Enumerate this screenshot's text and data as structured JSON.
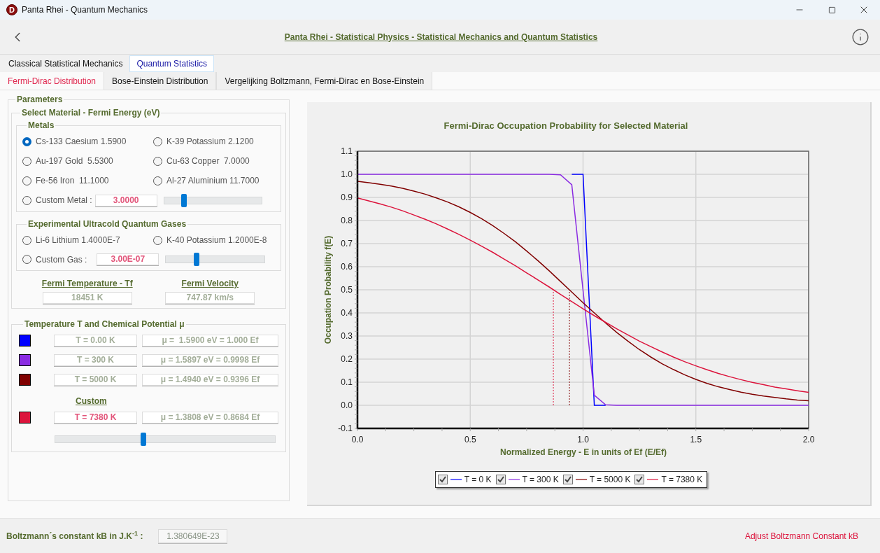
{
  "window": {
    "icon_letter": "D",
    "title": "Panta Rhei - Quantum Mechanics"
  },
  "header": {
    "title": "Panta Rhei - Statistical Physics - Statistical Mechanics and Quantum Statistics"
  },
  "tabs": [
    {
      "label": "Classical Statistical Mechanics",
      "selected": false
    },
    {
      "label": "Quantum Statistics",
      "selected": true
    }
  ],
  "subtabs": [
    {
      "label": "Fermi-Dirac Distribution",
      "selected": true
    },
    {
      "label": "Bose-Einstein Distribution",
      "selected": false
    },
    {
      "label": "Vergelijking Boltzmann, Fermi-Dirac en Bose-Einstein",
      "selected": false
    }
  ],
  "parameters": {
    "title": "Parameters",
    "material": {
      "title": "Select Material - Fermi Energy (eV)",
      "metals": {
        "title": "Metals",
        "options": [
          {
            "label": "Cs-133 Caesium 1.5900",
            "selected": true
          },
          {
            "label": "K-39 Potassium 2.1200",
            "selected": false
          },
          {
            "label": "Au-197 Gold  5.5300",
            "selected": false
          },
          {
            "label": "Cu-63 Copper  7.0000",
            "selected": false
          },
          {
            "label": "Fe-56 Iron  11.1000",
            "selected": false
          },
          {
            "label": "Al-27 Aluminium 11.7000",
            "selected": false
          }
        ],
        "custom": {
          "label": "Custom Metal :",
          "value": "3.0000",
          "selected": false,
          "level": 0.2
        }
      },
      "gases": {
        "title": "Experimental Ultracold Quantum Gases",
        "options": [
          {
            "label": "Li-6 Lithium 1.4000E-7",
            "selected": false
          },
          {
            "label": "K-40 Potassium 1.2000E-8",
            "selected": false
          }
        ],
        "custom": {
          "label": "Custom Gas :",
          "value": "3.00E-07",
          "selected": false,
          "level": 0.31
        }
      },
      "fermi_temperature": {
        "label": "Fermi Temperature - Tf",
        "value": "18451 K"
      },
      "fermi_velocity": {
        "label": "Fermi Velocity",
        "value": "747.87 km/s"
      }
    },
    "temperature": {
      "title": "Temperature T and Chemical Potential μ",
      "custom_label": "Custom",
      "rows": [
        {
          "kind": "preset",
          "color": "#0000ff",
          "temperature": "T = 0.00 K",
          "potential": "μ =  1.5900 eV = 1.000 Ef"
        },
        {
          "kind": "preset",
          "color": "#8a2be2",
          "temperature": "T = 300 K",
          "potential": "μ = 1.5897 eV = 0.9998 Ef"
        },
        {
          "kind": "preset",
          "color": "#800000",
          "temperature": "T = 5000 K",
          "potential": "μ = 1.4940 eV = 0.9396 Ef"
        },
        {
          "kind": "custom",
          "color": "#dc143c",
          "temperature": "T = 7380 K",
          "potential": "μ = 1.3808 eV = 0.8684 Ef"
        }
      ],
      "slider": {
        "level": 0.4
      }
    }
  },
  "chart": {
    "legend_checkboxes": [
      {
        "checked": true
      },
      {
        "checked": true
      },
      {
        "checked": true
      },
      {
        "checked": true
      }
    ],
    "chart_data": {
      "type": "line",
      "title": "Fermi-Dirac Occupation Probability for Selected Material",
      "xlabel": "Normalized Energy - E in units of Ef (E/Ef)",
      "ylabel": "Occupation Probability f(E)",
      "x": [
        0,
        0.05,
        0.1,
        0.15,
        0.2,
        0.25,
        0.3,
        0.35,
        0.4,
        0.45,
        0.5,
        0.55,
        0.6,
        0.65,
        0.7,
        0.75,
        0.8,
        0.85,
        0.9,
        0.95,
        1.0,
        1.05,
        1.1,
        1.15,
        1.2,
        1.25,
        1.3,
        1.35,
        1.4,
        1.45,
        1.5,
        1.55,
        1.6,
        1.65,
        1.7,
        1.75,
        1.8,
        1.85,
        1.9,
        1.95,
        2.0
      ],
      "series": [
        {
          "name": "T = 0 K",
          "color": "#0000ff",
          "values": [
            null,
            null,
            null,
            null,
            null,
            null,
            null,
            null,
            null,
            null,
            null,
            null,
            null,
            null,
            null,
            null,
            null,
            null,
            null,
            1,
            1,
            0,
            0,
            null,
            null,
            null,
            null,
            null,
            null,
            null,
            null,
            null,
            null,
            null,
            null,
            null,
            null,
            null,
            null,
            null,
            null
          ]
        },
        {
          "name": "T = 300 K",
          "color": "#8a2be2",
          "values": [
            1,
            1,
            1,
            1,
            1,
            1,
            1,
            1,
            1,
            1,
            1,
            1,
            1,
            1,
            1,
            1,
            1,
            1,
            0.998,
            0.955,
            0.497,
            0.044,
            0.002,
            0,
            0,
            0,
            0,
            0,
            0,
            0,
            0,
            0,
            0,
            0,
            0,
            0,
            0,
            0,
            0,
            0,
            0
          ]
        },
        {
          "name": "T = 5000 K",
          "color": "#800000",
          "values": [
            0.97,
            0.964,
            0.957,
            0.949,
            0.939,
            0.927,
            0.914,
            0.898,
            0.88,
            0.859,
            0.835,
            0.808,
            0.778,
            0.744,
            0.708,
            0.668,
            0.626,
            0.582,
            0.536,
            0.49,
            0.444,
            0.4,
            0.356,
            0.315,
            0.277,
            0.241,
            0.209,
            0.18,
            0.155,
            0.132,
            0.112,
            0.095,
            0.08,
            0.068,
            0.057,
            0.048,
            0.04,
            0.034,
            0.028,
            0.023,
            0.02
          ]
        },
        {
          "name": "T = 7380 K",
          "color": "#dc143c",
          "values": [
            0.898,
            0.885,
            0.872,
            0.858,
            0.842,
            0.824,
            0.805,
            0.785,
            0.763,
            0.74,
            0.715,
            0.689,
            0.662,
            0.633,
            0.604,
            0.573,
            0.543,
            0.512,
            0.48,
            0.449,
            0.418,
            0.388,
            0.359,
            0.331,
            0.304,
            0.278,
            0.254,
            0.231,
            0.209,
            0.189,
            0.171,
            0.154,
            0.138,
            0.124,
            0.111,
            0.099,
            0.089,
            0.079,
            0.071,
            0.063,
            0.056
          ]
        }
      ],
      "xlim": [
        0,
        2
      ],
      "ylim": [
        -0.1,
        1.1
      ],
      "grid": true,
      "legend": "bottom",
      "xticks": [
        {
          "value": 0,
          "label": "0.0"
        },
        {
          "value": 0.5,
          "label": "0.5"
        },
        {
          "value": 1,
          "label": "1.0"
        },
        {
          "value": 1.5,
          "label": "1.5"
        },
        {
          "value": 2,
          "label": "2.0"
        }
      ],
      "yticks": [
        {
          "value": -0.1,
          "label": "-0.1"
        },
        {
          "value": 0,
          "label": "0.0"
        },
        {
          "value": 0.1,
          "label": "0.1"
        },
        {
          "value": 0.2,
          "label": "0.2"
        },
        {
          "value": 0.3,
          "label": "0.3"
        },
        {
          "value": 0.4,
          "label": "0.4"
        },
        {
          "value": 0.5,
          "label": "0.5"
        },
        {
          "value": 0.6,
          "label": "0.6"
        },
        {
          "value": 0.7,
          "label": "0.7"
        },
        {
          "value": 0.8,
          "label": "0.8"
        },
        {
          "value": 0.9,
          "label": "0.9"
        },
        {
          "value": 1,
          "label": "1.0"
        },
        {
          "value": 1.1,
          "label": "1.1"
        }
      ],
      "ref_lines": [
        {
          "axis": "x",
          "value": 0.8684,
          "color": "#dc143c"
        },
        {
          "axis": "x",
          "value": 0.9396,
          "color": "#800000"
        }
      ]
    }
  },
  "status_bar": {
    "label": "Boltzmann´s constant kB in J.K$^{-1}$ :",
    "value": "1.380649E-23",
    "link": "Adjust Boltzmann Constant kB"
  }
}
